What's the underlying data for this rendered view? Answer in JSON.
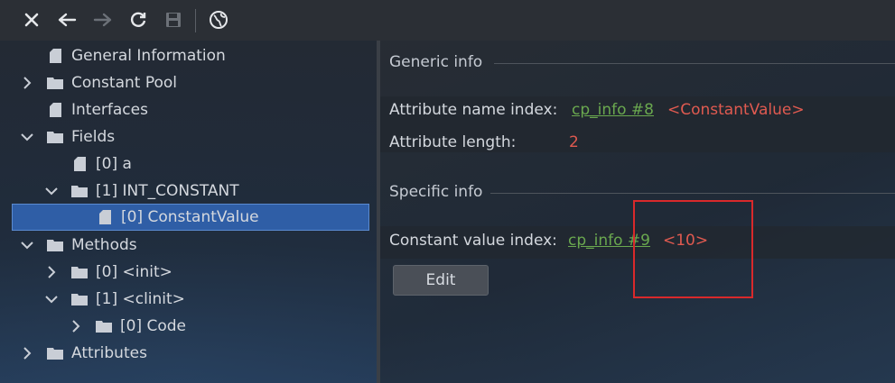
{
  "toolbar": {
    "buttons": [
      {
        "icon": "close-icon"
      },
      {
        "icon": "back-arrow-icon"
      },
      {
        "icon": "forward-arrow-icon"
      },
      {
        "icon": "refresh-icon"
      },
      {
        "icon": "save-icon"
      },
      {
        "icon": "globe-icon"
      }
    ]
  },
  "tree": {
    "items": [
      {
        "label": "General Information"
      },
      {
        "label": "Constant Pool"
      },
      {
        "label": "Interfaces"
      },
      {
        "label": "Fields"
      },
      {
        "label": "[0] a"
      },
      {
        "label": "[1] INT_CONSTANT"
      },
      {
        "label": "[0] ConstantValue"
      },
      {
        "label": "Methods"
      },
      {
        "label": "[0] <init>"
      },
      {
        "label": "[1] <clinit>"
      },
      {
        "label": "[0] Code"
      },
      {
        "label": "Attributes"
      }
    ]
  },
  "detail": {
    "generic_title": "Generic info",
    "attr_name_label": "Attribute name index:",
    "attr_name_link": "cp_info #8",
    "attr_name_value": "<ConstantValue>",
    "attr_length_label": "Attribute length:",
    "attr_length_value": "2",
    "specific_title": "Specific info",
    "const_label": "Constant value index:",
    "const_link": "cp_info #9",
    "const_value": "<10>",
    "edit_label": "Edit"
  },
  "colors": {
    "link": "#6aa84f",
    "value": "#e05a50",
    "selection": "#2f5ea6",
    "annotation": "#d9292b"
  }
}
